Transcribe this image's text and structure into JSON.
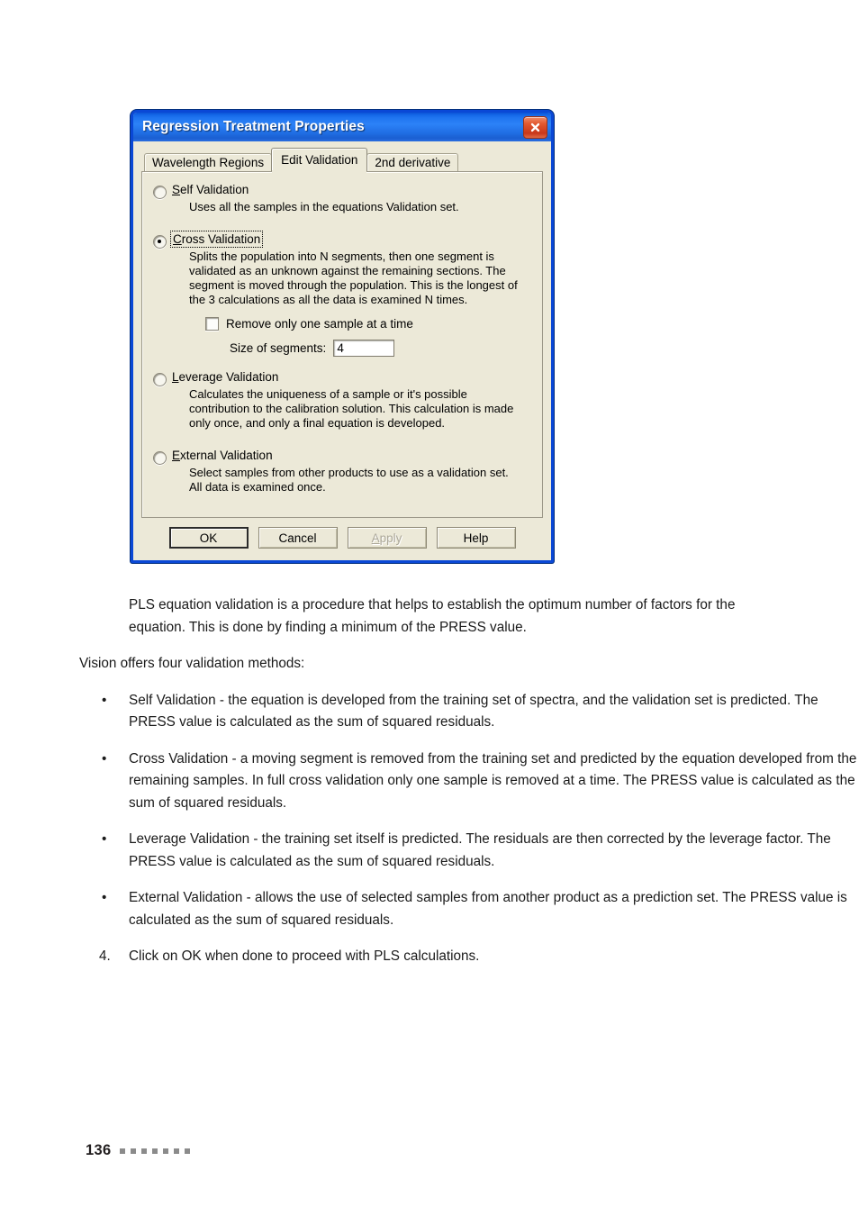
{
  "dialog": {
    "title": "Regression Treatment Properties",
    "close_icon": "close-icon",
    "tabs": [
      {
        "label": "Wavelength Regions",
        "active": false
      },
      {
        "label": "Edit Validation",
        "active": true
      },
      {
        "label": "2nd derivative",
        "active": false
      }
    ],
    "options": [
      {
        "id": "self-validation",
        "accel": "S",
        "rest": "elf Validation",
        "selected": false,
        "focused": false,
        "desc": [
          "Uses all the samples in the equations Validation set."
        ]
      },
      {
        "id": "cross-validation",
        "accel": "C",
        "rest": "ross Validation",
        "selected": true,
        "focused": true,
        "desc": [
          "Splits the population into N segments, then one segment is",
          "validated as an unknown against the remaining sections. The",
          "segment is moved through the population. This is the longest of",
          "the 3 calculations as all the data is examined N times."
        ]
      },
      {
        "id": "leverage-validation",
        "accel": "L",
        "rest": "everage Validation",
        "selected": false,
        "focused": false,
        "desc": [
          "Calculates the uniqueness of a sample or it's possible",
          "contribution to the calibration solution.  This calculation is made",
          "only once, and only a final equation is developed."
        ]
      },
      {
        "id": "external-validation",
        "accel": "E",
        "rest": "xternal Validation",
        "selected": false,
        "focused": false,
        "desc": [
          "Select samples from other products to use as a validation set.",
          "All data is examined once."
        ]
      }
    ],
    "checkbox": {
      "label": "Remove only one sample at a time",
      "checked": false
    },
    "segments": {
      "label": "Size of segments:",
      "value": "4"
    },
    "buttons": [
      {
        "id": "ok",
        "label": "OK",
        "accel": "",
        "rest": "OK",
        "default": true,
        "disabled": false
      },
      {
        "id": "cancel",
        "label": "Cancel",
        "accel": "",
        "rest": "Cancel",
        "default": false,
        "disabled": false
      },
      {
        "id": "apply",
        "label": "Apply",
        "accel": "A",
        "rest": "pply",
        "default": false,
        "disabled": true
      },
      {
        "id": "help",
        "label": "Help",
        "accel": "",
        "rest": "Help",
        "default": false,
        "disabled": false
      }
    ]
  },
  "document": {
    "intro_paragraph": "PLS equation validation is a procedure that helps to establish the optimum number of factors for the equation. This is done by finding a minimum of the PRESS value.",
    "lead_in": "Vision offers four validation methods:",
    "bullet_marker": "•",
    "bullets": [
      "Self Validation - the equation is developed from the training set of spectra, and the validation set is predicted. The PRESS value is calculated as the sum of squared residuals.",
      "Cross Validation - a moving segment is removed from the training set and predicted by the equation developed from the remaining samples. In full cross validation only one sample is removed at a time. The PRESS value is calculated as the sum of squared residuals.",
      "Leverage Validation - the training set itself is predicted. The residuals are then corrected by the leverage factor. The PRESS value is calculated as the sum of squared residuals.",
      "External Validation - allows the use of selected samples from another product as a prediction set. The PRESS value is calculated as the sum of squared residuals."
    ],
    "numbered_step": {
      "marker": "4.",
      "text": "Click on OK when done to proceed with PLS calculations."
    }
  },
  "footer": {
    "page_number": "136",
    "dot_count": 7
  },
  "colors": {
    "title_blue": "#1f74f0",
    "dialog_face": "#ece9d8",
    "close_red": "#e2582f",
    "border_blue": "#0a48d6"
  }
}
